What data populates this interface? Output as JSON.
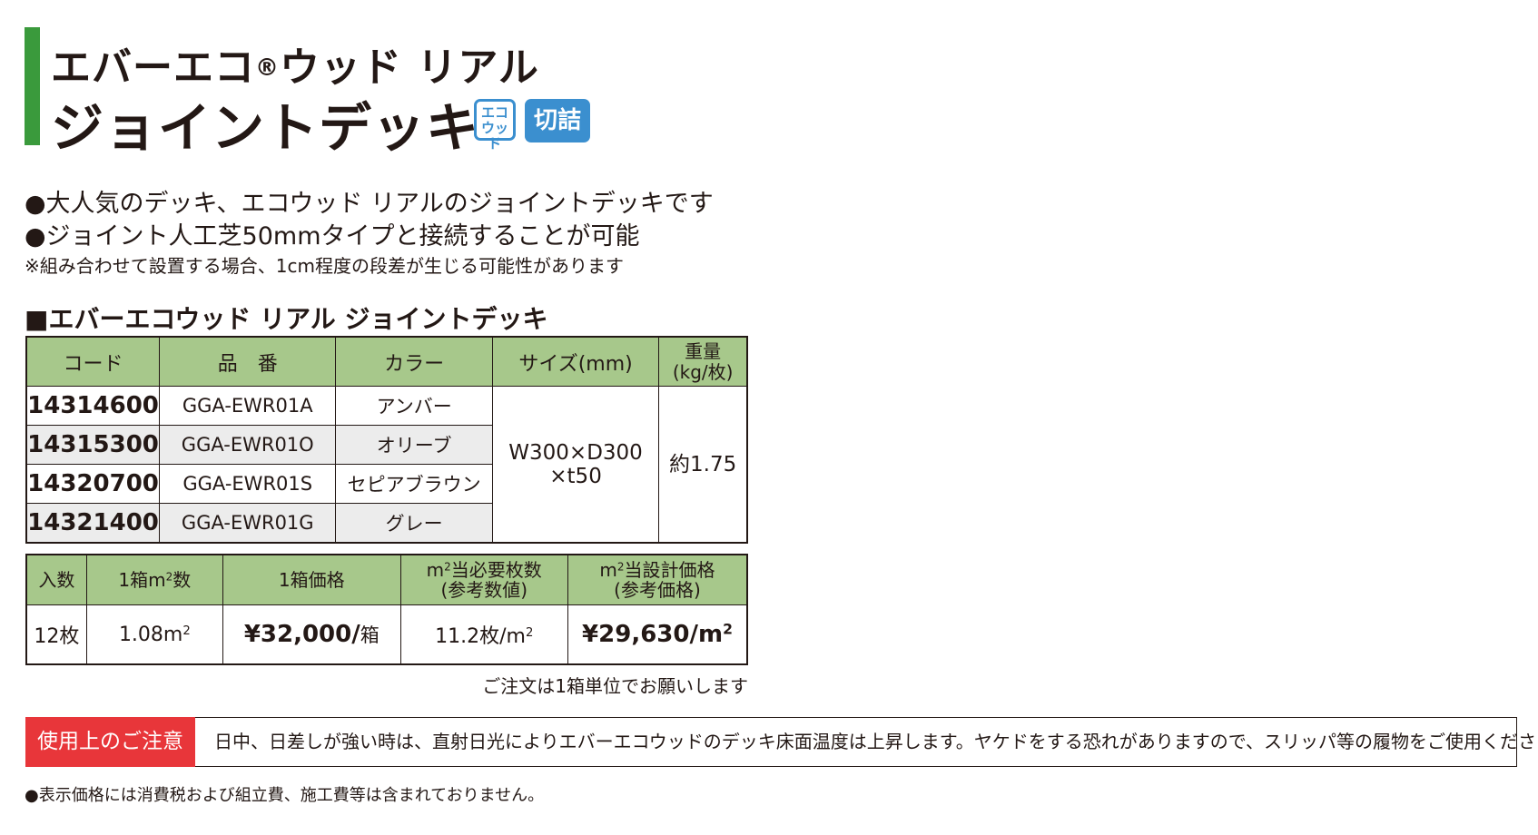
{
  "header": {
    "title_line1_pre": "エバーエコ",
    "title_line1_reg": "®",
    "title_line1_post": "ウッド リアル",
    "title_line2": "ジョイントデッキ",
    "badge_eco_line1": "エコ",
    "badge_eco_line2": "ウッド",
    "badge_cut": "切詰可",
    "accent_color": "#3a9a3c",
    "badge_color": "#3b8fcf"
  },
  "features": [
    "●大人気のデッキ、エコウッド リアルのジョイントデッキです",
    "●ジョイント人工芝50mmタイプと接続することが可能"
  ],
  "features_note": "※組み合わせて設置する場合、1cm程度の段差が生じる可能性があります",
  "section_title": "■エバーエコウッド リアル ジョイントデッキ",
  "product_table": {
    "headers": [
      "コード",
      "品　番",
      "カラー",
      "サイズ(mm)",
      "重量",
      "(kg/枚)"
    ],
    "rows": [
      {
        "code": "14314600",
        "part": "GGA-EWR01A",
        "color": "アンバー"
      },
      {
        "code": "14315300",
        "part": "GGA-EWR01O",
        "color": "オリーブ"
      },
      {
        "code": "14320700",
        "part": "GGA-EWR01S",
        "color": "セピアブラウン"
      },
      {
        "code": "14321400",
        "part": "GGA-EWR01G",
        "color": "グレー"
      }
    ],
    "size_line1": "W300×D300",
    "size_line2": "×t50",
    "weight": "約1.75",
    "header_color": "#a7c88b"
  },
  "price_table": {
    "h_qty": "入数",
    "h_area_pre": "1箱m",
    "h_area_post": "数",
    "h_price": "1箱価格",
    "h_need_pre": "m",
    "h_need_post": "当必要枚数",
    "h_need_sub": "(参考数値)",
    "h_design_pre": "m",
    "h_design_post": "当設計価格",
    "h_design_sub": "(参考価格)",
    "sq": "2",
    "qty": "12枚",
    "area": "1.08m",
    "price": "¥32,000/",
    "price_unit": "箱",
    "need": "11.2枚/m",
    "design_price": "¥29,630/m"
  },
  "order_note": "ご注文は1箱単位でお願いします",
  "caution": {
    "label": "使用上のご注意",
    "text": "日中、日差しが強い時は、直射日光によりエバーエコウッドのデッキ床面温度は上昇します。ヤケドをする恐れがありますので、スリッパ等の履物をご使用ください。",
    "label_color": "#e8363a"
  },
  "footer_note": "●表示価格には消費税および組立費、施工費等は含まれておりません。"
}
